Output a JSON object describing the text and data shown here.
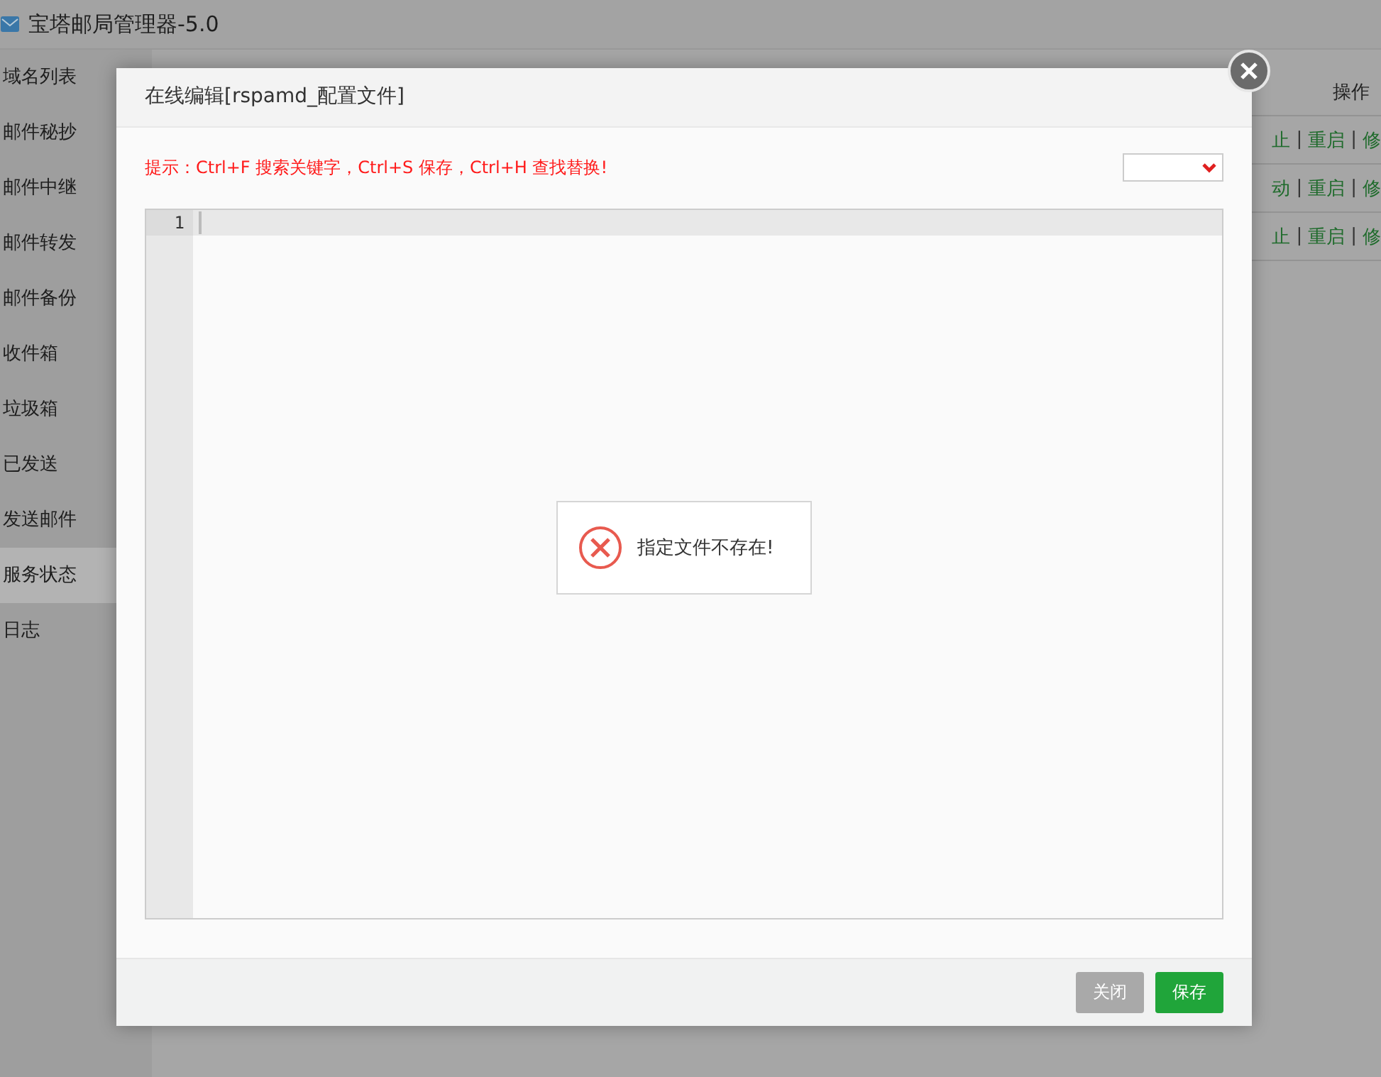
{
  "app": {
    "title": "宝塔邮局管理器-5.0"
  },
  "sidebar": {
    "items": [
      {
        "label": "域名列表",
        "selected": false
      },
      {
        "label": "邮件秘抄",
        "selected": false
      },
      {
        "label": "邮件中继",
        "selected": false
      },
      {
        "label": "邮件转发",
        "selected": false
      },
      {
        "label": "邮件备份",
        "selected": false
      },
      {
        "label": "收件箱",
        "selected": false
      },
      {
        "label": "垃圾箱",
        "selected": false
      },
      {
        "label": "已发送",
        "selected": false
      },
      {
        "label": "发送邮件",
        "selected": false
      },
      {
        "label": "服务状态",
        "selected": true
      },
      {
        "label": "日志",
        "selected": false
      }
    ]
  },
  "table": {
    "columns": [
      "操作"
    ],
    "rows": [
      {
        "actions": [
          {
            "kind": "link",
            "text": "止"
          },
          {
            "kind": "separator",
            "text": "|"
          },
          {
            "kind": "link",
            "text": "重启"
          },
          {
            "kind": "separator",
            "text": "|"
          },
          {
            "kind": "link",
            "text": "修"
          }
        ]
      },
      {
        "actions": [
          {
            "kind": "link",
            "text": "动"
          },
          {
            "kind": "separator",
            "text": "|"
          },
          {
            "kind": "link",
            "text": "重启"
          },
          {
            "kind": "separator",
            "text": "|"
          },
          {
            "kind": "link",
            "text": "修"
          }
        ]
      },
      {
        "actions": [
          {
            "kind": "link",
            "text": "止"
          },
          {
            "kind": "separator",
            "text": "|"
          },
          {
            "kind": "link",
            "text": "重启"
          },
          {
            "kind": "separator",
            "text": "|"
          },
          {
            "kind": "link",
            "text": "修"
          }
        ]
      }
    ]
  },
  "dialog": {
    "title": "在线编辑[rspamd_配置文件]",
    "hint": "提示：Ctrl+F 搜索关键字，Ctrl+S 保存，Ctrl+H 查找替换!",
    "editor": {
      "line_numbers": [
        "1"
      ]
    },
    "toast": {
      "message": "指定文件不存在!"
    },
    "buttons": [
      {
        "kind": "close",
        "label": "关闭",
        "disabled": true
      },
      {
        "kind": "save",
        "label": "保存",
        "disabled": false
      }
    ]
  }
}
